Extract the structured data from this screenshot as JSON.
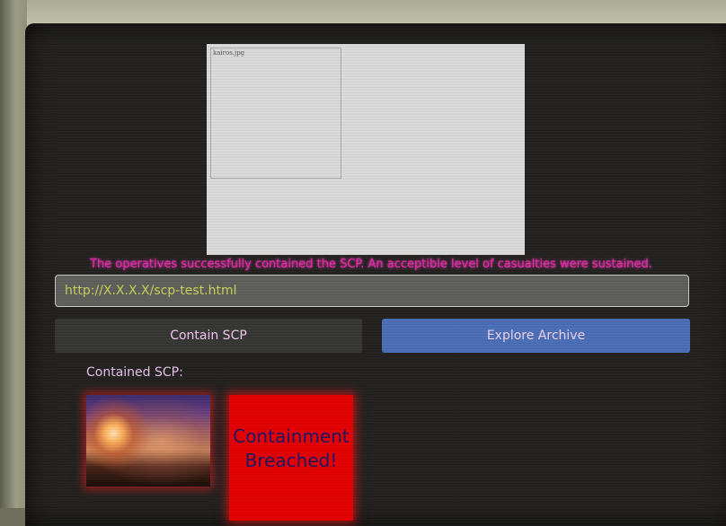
{
  "preview": {
    "image_alt": "kairos.jpg"
  },
  "status_message": "The operatives successfully contained the SCP. An acceptible level of casualties were sustained.",
  "url_field": {
    "value": "http://X.X.X.X/scp-test.html"
  },
  "buttons": {
    "contain": "Contain SCP",
    "explore": "Explore Archive"
  },
  "contained": {
    "label": "Contained SCP:",
    "breach_line1": "Containment",
    "breach_line2": "Breached!"
  },
  "colors": {
    "message": "#e02aa8",
    "url_text": "#c7d35a",
    "explore_button": "#4b6fb8",
    "breach_box": "#e50000"
  }
}
